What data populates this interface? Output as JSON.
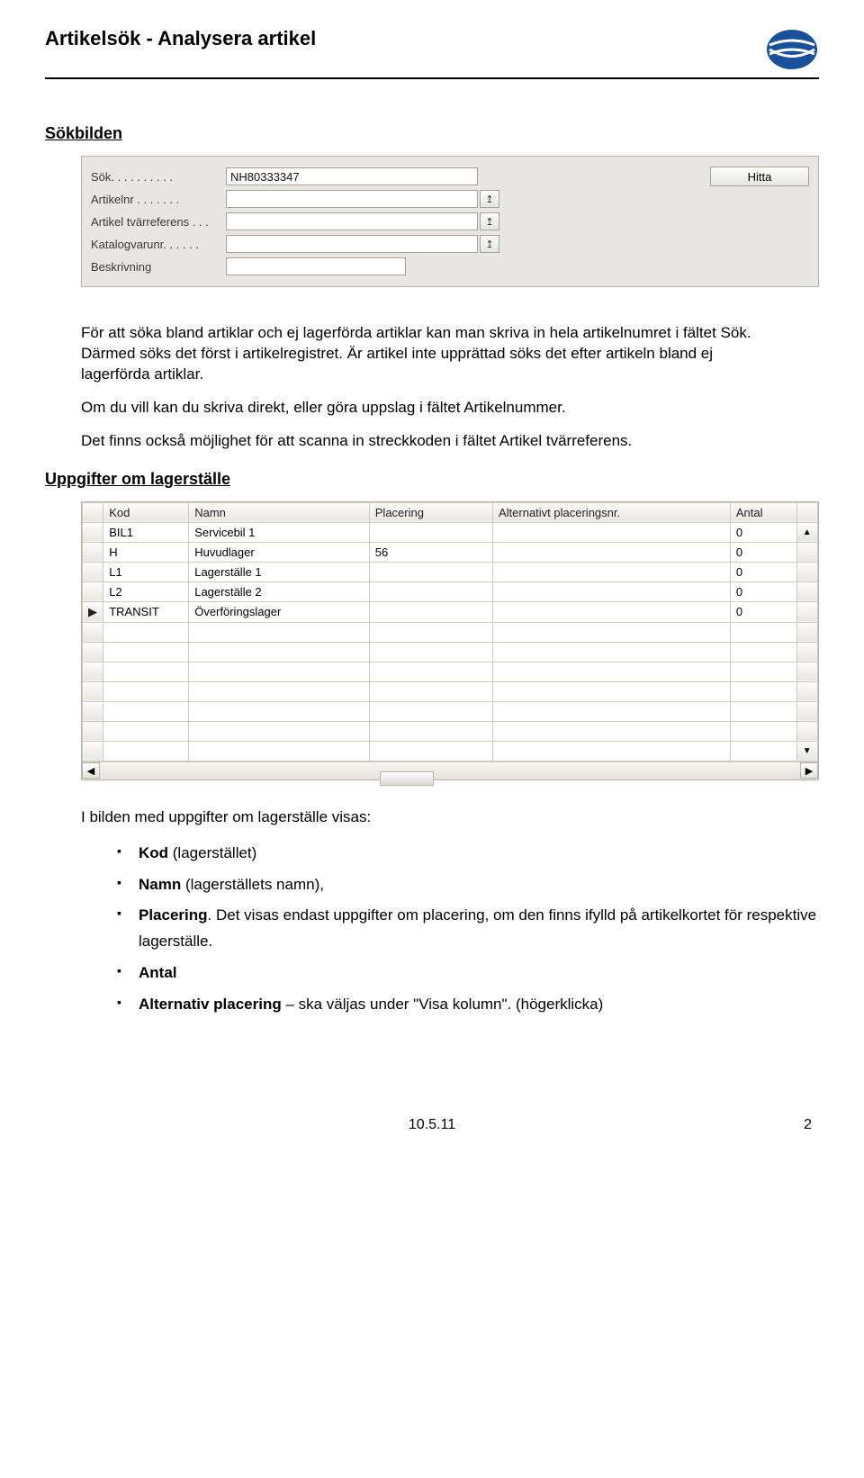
{
  "header": {
    "title": "Artikelsök - Analysera artikel"
  },
  "section1": {
    "heading": "Sökbilden"
  },
  "search_panel": {
    "rows": [
      {
        "label": "Sök. . . . . . . . . .",
        "value": "NH80333347",
        "has_lookup": false
      },
      {
        "label": "Artikelnr  . . . . . . .",
        "value": "",
        "has_lookup": true
      },
      {
        "label": "Artikel tvärreferens . . .",
        "value": "",
        "has_lookup": true
      },
      {
        "label": "Katalogvarunr. . . . . .",
        "value": "",
        "has_lookup": true
      },
      {
        "label": "Beskrivning",
        "value": "",
        "has_lookup": false
      }
    ],
    "hitta_label": "Hitta"
  },
  "paragraphs": {
    "p1": "För att söka bland artiklar och ej lagerförda artiklar kan man skriva in hela artikelnumret i fältet Sök. Därmed söks det först i artikelregistret. Är artikel inte upprättad söks det efter artikeln bland ej lagerförda artiklar.",
    "p2": "Om du vill kan du skriva direkt, eller göra uppslag i fältet Artikelnummer.",
    "p3": "Det finns också möjlighet för att scanna in streckkoden i fältet Artikel tvärreferens."
  },
  "section2": {
    "heading": "Uppgifter om lagerställe"
  },
  "table": {
    "headers": {
      "kod": "Kod",
      "namn": "Namn",
      "placering": "Placering",
      "alt": "Alternativt placeringsnr.",
      "antal": "Antal"
    },
    "rows": [
      {
        "mark": "",
        "kod": "BIL1",
        "namn": "Servicebil 1",
        "placering": "",
        "alt": "",
        "antal": "0"
      },
      {
        "mark": "",
        "kod": "H",
        "namn": "Huvudlager",
        "placering": "56",
        "alt": "",
        "antal": "0"
      },
      {
        "mark": "",
        "kod": "L1",
        "namn": "Lagerställe 1",
        "placering": "",
        "alt": "",
        "antal": "0"
      },
      {
        "mark": "",
        "kod": "L2",
        "namn": "Lagerställe 2",
        "placering": "",
        "alt": "",
        "antal": "0"
      },
      {
        "mark": "▶",
        "kod": "TRANSIT",
        "namn": "Överföringslager",
        "placering": "",
        "alt": "",
        "antal": "0"
      }
    ]
  },
  "paragraphs2": {
    "intro": "I bilden med uppgifter om lagerställe visas:"
  },
  "bullets": {
    "b1_bold": "Kod",
    "b1_rest": " (lagerstället)",
    "b2_bold": "Namn",
    "b2_rest": " (lagerställets namn),",
    "b3_bold": "Placering",
    "b3_rest": ". Det visas endast uppgifter om placering, om den finns ifylld på artikelkortet för respektive lagerställe.",
    "b4_bold": "Antal",
    "b5_bold": "Alternativ placering",
    "b5_rest": " – ska väljas under \"Visa kolumn\". (högerklicka)"
  },
  "footer": {
    "date": "10.5.11",
    "page": "2"
  }
}
